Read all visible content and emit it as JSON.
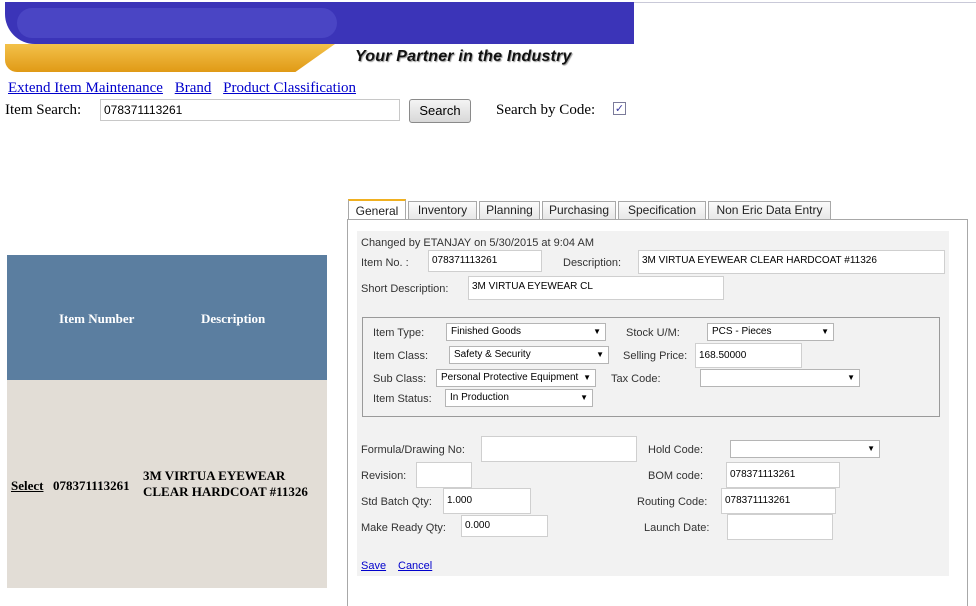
{
  "banner": {
    "tagline": "Your Partner in the Industry"
  },
  "links": [
    "Extend Item Maintenance",
    "Brand",
    "Product Classification"
  ],
  "search": {
    "label": "Item Search:",
    "value": "078371113261",
    "button": "Search",
    "by_code_label": "Search by Code:",
    "by_code_checked": "✓"
  },
  "grid": {
    "headers": {
      "item_number": "Item Number",
      "description": "Description"
    },
    "rows": [
      {
        "select": "Select",
        "item_number": "078371113261",
        "description": "3M VIRTUA EYEWEAR CLEAR HARDCOAT #11326"
      }
    ]
  },
  "tabs": [
    "General",
    "Inventory",
    "Planning",
    "Purchasing",
    "Specification",
    "Non Eric Data Entry"
  ],
  "general": {
    "changed_by": "Changed by ETANJAY on 5/30/2015 at 9:04 AM",
    "item_no_label": "Item No. :",
    "item_no": "078371113261",
    "description_label": "Description:",
    "description": "3M VIRTUA EYEWEAR CLEAR HARDCOAT #11326",
    "short_desc_label": "Short Description:",
    "short_desc": "3M VIRTUA EYEWEAR CL",
    "item_type_label": "Item Type:",
    "item_type": "Finished Goods",
    "stock_um_label": "Stock U/M:",
    "stock_um": "PCS - Pieces",
    "item_class_label": "Item Class:",
    "item_class": "Safety & Security",
    "selling_price_label": "Selling Price:",
    "selling_price": "168.50000",
    "sub_class_label": "Sub Class:",
    "sub_class": "Personal Protective Equipment",
    "tax_code_label": "Tax Code:",
    "tax_code": "",
    "item_status_label": "Item Status:",
    "item_status": "In Production",
    "formula_label": "Formula/Drawing No:",
    "formula": "",
    "hold_code_label": "Hold Code:",
    "hold_code": "",
    "revision_label": "Revision:",
    "revision": "",
    "bom_code_label": "BOM code:",
    "bom_code": "078371113261",
    "std_batch_label": "Std Batch Qty:",
    "std_batch": "1.000",
    "routing_label": "Routing Code:",
    "routing": "078371113261",
    "make_ready_label": "Make Ready Qty:",
    "make_ready": "0.000",
    "launch_label": "Launch Date:",
    "launch": "",
    "save": "Save",
    "cancel": "Cancel"
  }
}
